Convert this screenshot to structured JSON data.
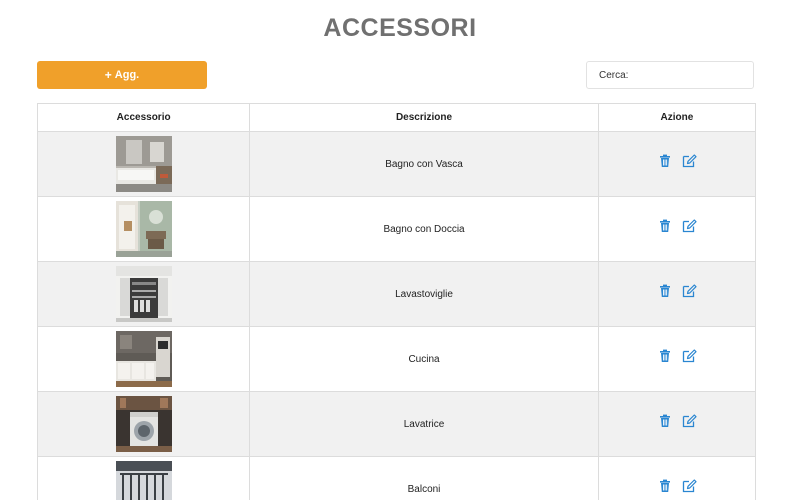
{
  "page": {
    "title": "ACCESSORI"
  },
  "toolbar": {
    "add_icon": "+",
    "add_label": "Agg.",
    "search_label": "Cerca:",
    "search_value": ""
  },
  "table": {
    "headers": {
      "accessorio": "Accessorio",
      "descrizione": "Descrizione",
      "azione": "Azione"
    },
    "rows": [
      {
        "image": "bathroom-with-tub-photo",
        "description": "Bagno con Vasca"
      },
      {
        "image": "bathroom-with-shower-photo",
        "description": "Bagno con Doccia"
      },
      {
        "image": "dishwasher-photo",
        "description": "Lavastoviglie"
      },
      {
        "image": "kitchen-photo",
        "description": "Cucina"
      },
      {
        "image": "washing-machine-photo",
        "description": "Lavatrice"
      },
      {
        "image": "balcony-photo",
        "description": "Balconi"
      }
    ]
  },
  "colors": {
    "accent": "#f0a02a",
    "action_icon": "#2a86d1",
    "title": "#707070",
    "row_stripe": "#f1f1f1"
  },
  "icons": {
    "delete": "trash-icon",
    "edit": "edit-icon",
    "add": "plus-icon"
  }
}
